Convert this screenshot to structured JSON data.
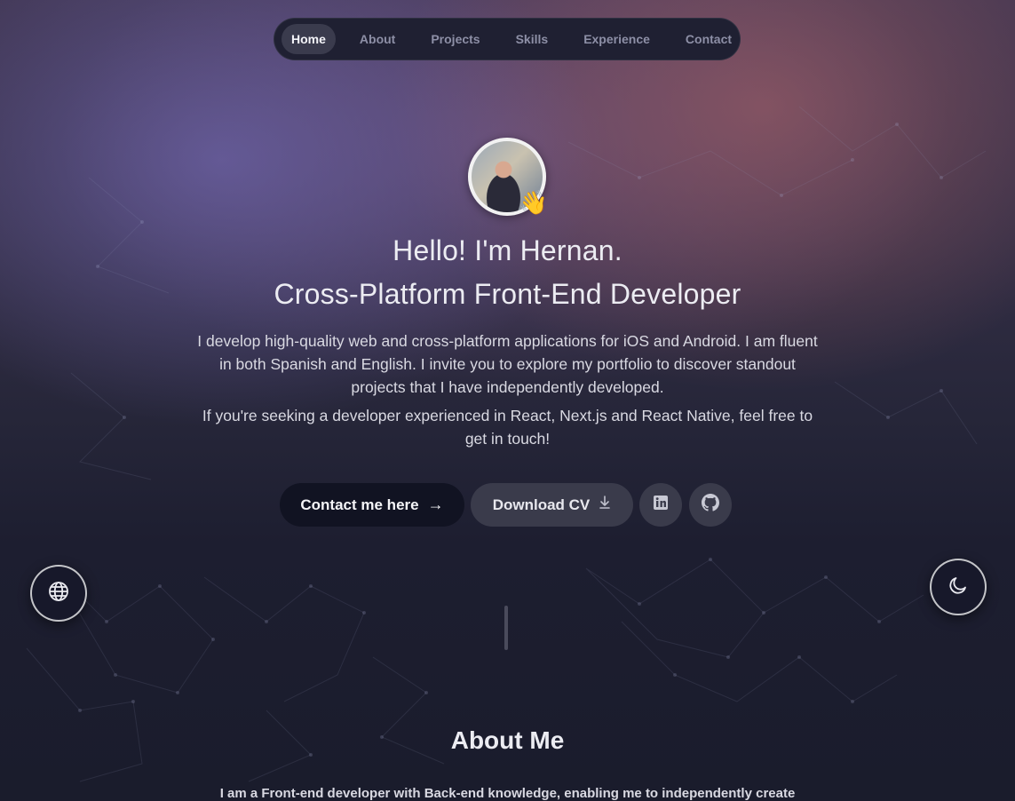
{
  "nav": {
    "items": [
      {
        "label": "Home",
        "active": true
      },
      {
        "label": "About",
        "active": false
      },
      {
        "label": "Projects",
        "active": false
      },
      {
        "label": "Skills",
        "active": false
      },
      {
        "label": "Experience",
        "active": false
      },
      {
        "label": "Contact",
        "active": false
      }
    ]
  },
  "hero": {
    "greeting": "Hello! I'm Hernan.",
    "role": "Cross-Platform Front-End Developer",
    "intro": "I develop high-quality web and cross-platform applications for iOS and Android. I am fluent in both Spanish and English. I invite you to explore my portfolio to discover standout projects that I have independently developed.",
    "cta_text": "If you're seeking a developer experienced in React, Next.js and React Native, feel free to get in touch!",
    "wave_emoji": "👋"
  },
  "actions": {
    "contact_label": "Contact me here",
    "contact_icon": "→",
    "cv_label": "Download CV",
    "cv_icon": "download-icon",
    "linkedin_icon": "linkedin-icon",
    "github_icon": "github-icon"
  },
  "floating": {
    "language_icon": "globe-icon",
    "theme_icon": "moon-icon"
  },
  "about": {
    "title": "About Me",
    "text": "I am a Front-end developer with Back-end knowledge, enabling me to independently create"
  },
  "colors": {
    "nav_bg": "#1f2032",
    "nav_active_bg": "#3a3b4d",
    "primary_button": "#111322",
    "secondary_button": "#3a3b4b"
  }
}
